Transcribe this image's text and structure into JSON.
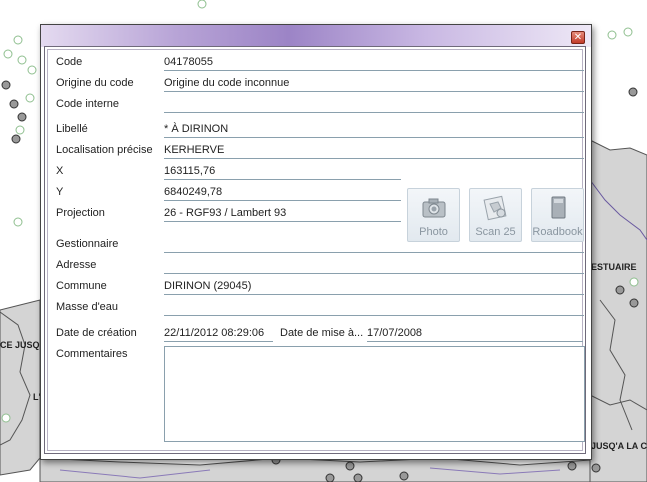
{
  "map": {
    "labels": [
      "ESTUAIRE",
      "CE JUSQU",
      "JUSQ'A LA CO",
      "L'"
    ]
  },
  "dialog": {
    "close_glyph": "✕",
    "fields": {
      "code": {
        "label": "Code",
        "value": "04178055"
      },
      "origine": {
        "label": "Origine du code",
        "value": "Origine du code inconnue"
      },
      "code_interne": {
        "label": "Code interne",
        "value": ""
      },
      "libelle": {
        "label": "Libellé",
        "value": "* À DIRINON"
      },
      "localisation": {
        "label": "Localisation précise",
        "value": "KERHERVE"
      },
      "x": {
        "label": "X",
        "value": "163115,76"
      },
      "y": {
        "label": "Y",
        "value": "6840249,78"
      },
      "projection": {
        "label": "Projection",
        "value": "26 - RGF93 / Lambert 93"
      },
      "gestionnaire": {
        "label": "Gestionnaire",
        "value": ""
      },
      "adresse": {
        "label": "Adresse",
        "value": ""
      },
      "commune": {
        "label": "Commune",
        "value": "DIRINON (29045)"
      },
      "masse_eau": {
        "label": "Masse d'eau",
        "value": ""
      },
      "date_creation": {
        "label": "Date de création",
        "value": "22/11/2012 08:29:06"
      },
      "date_maj": {
        "label": "Date de mise à...",
        "value": "17/07/2008"
      },
      "commentaires": {
        "label": "Commentaires",
        "value": ""
      }
    },
    "buttons": {
      "photo": {
        "label": "Photo",
        "icon": "camera-icon"
      },
      "scan": {
        "label": "Scan 25",
        "icon": "map-scan-icon"
      },
      "roadbook": {
        "label": "Roadbook",
        "icon": "book-icon"
      }
    }
  }
}
